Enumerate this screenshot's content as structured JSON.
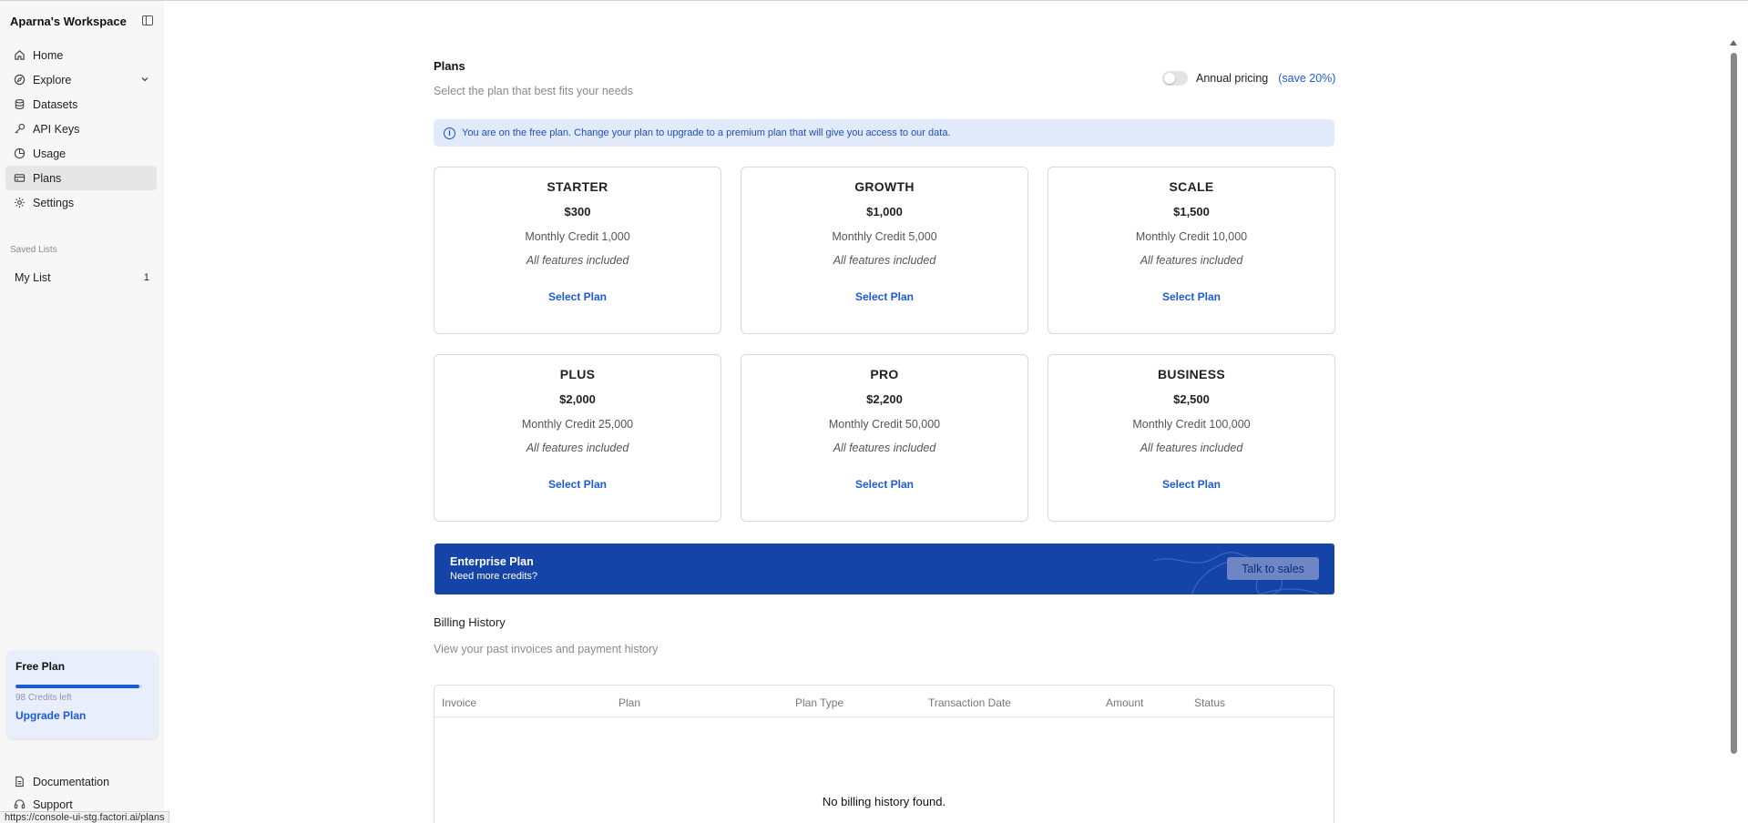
{
  "sidebar": {
    "workspace_title": "Aparna's Workspace",
    "nav": [
      {
        "label": "Home",
        "icon": "home-icon"
      },
      {
        "label": "Explore",
        "icon": "compass-icon"
      },
      {
        "label": "Datasets",
        "icon": "database-icon"
      },
      {
        "label": "API Keys",
        "icon": "key-icon"
      },
      {
        "label": "Usage",
        "icon": "pie-chart-icon"
      },
      {
        "label": "Plans",
        "icon": "credit-card-icon",
        "active": true
      },
      {
        "label": "Settings",
        "icon": "gear-icon"
      }
    ],
    "saved_lists_label": "Saved Lists",
    "saved_lists": [
      {
        "label": "My List",
        "count": "1"
      }
    ],
    "plan_card": {
      "title": "Free Plan",
      "credits_text": "98 Credits left",
      "progress_fraction": 0.98,
      "upgrade_label": "Upgrade Plan"
    },
    "footer_nav": [
      {
        "label": "Documentation",
        "icon": "document-icon"
      },
      {
        "label": "Support",
        "icon": "headset-icon"
      }
    ]
  },
  "status_bar_url": "https://console-ui-stg.factori.ai/plans",
  "plans_page": {
    "title": "Plans",
    "subtitle": "Select the plan that best fits your needs",
    "annual_toggle": {
      "label": "Annual pricing",
      "save_text": "(save 20%)",
      "enabled": false
    },
    "info_banner": "You are on the free plan. Change your plan to upgrade to a premium plan that will give you access to our data.",
    "tiers": [
      {
        "name": "STARTER",
        "price": "$300",
        "credit": "Monthly Credit 1,000",
        "features": "All features included",
        "cta": "Select Plan"
      },
      {
        "name": "GROWTH",
        "price": "$1,000",
        "credit": "Monthly Credit 5,000",
        "features": "All features included",
        "cta": "Select Plan"
      },
      {
        "name": "SCALE",
        "price": "$1,500",
        "credit": "Monthly Credit 10,000",
        "features": "All features included",
        "cta": "Select Plan"
      },
      {
        "name": "PLUS",
        "price": "$2,000",
        "credit": "Monthly Credit 25,000",
        "features": "All features included",
        "cta": "Select Plan"
      },
      {
        "name": "PRO",
        "price": "$2,200",
        "credit": "Monthly Credit 50,000",
        "features": "All features included",
        "cta": "Select Plan"
      },
      {
        "name": "BUSINESS",
        "price": "$2,500",
        "credit": "Monthly Credit 100,000",
        "features": "All features included",
        "cta": "Select Plan"
      }
    ],
    "enterprise": {
      "title": "Enterprise Plan",
      "subtitle": "Need more credits?",
      "cta": "Talk to sales",
      "bg_color": "#1444a8"
    },
    "billing": {
      "title": "Billing History",
      "subtitle": "View your past invoices and payment history",
      "columns": [
        "Invoice",
        "Plan",
        "Plan Type",
        "Transaction Date",
        "Amount",
        "Status"
      ],
      "empty_text": "No billing history found."
    }
  },
  "colors": {
    "accent": "#1d5bd6",
    "sidebar_bg": "#f7f7f7",
    "banner_bg": "#e1eafb"
  }
}
